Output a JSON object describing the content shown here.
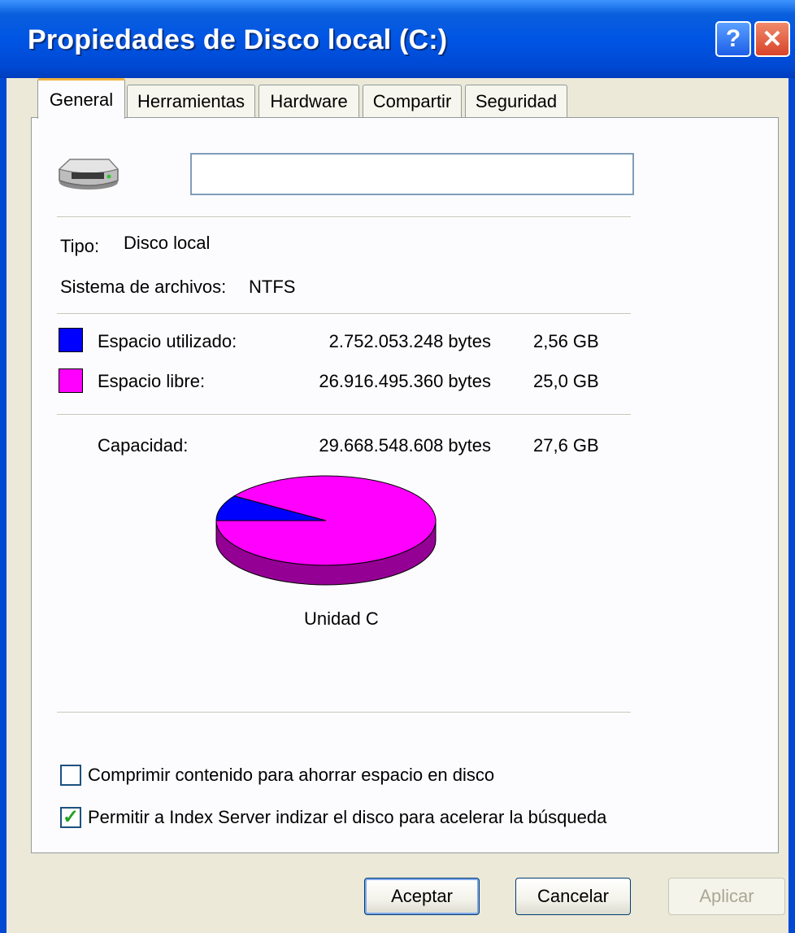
{
  "window": {
    "title": "Propiedades de Disco local (C:)",
    "help_label": "?",
    "close_label": "✕"
  },
  "tabs": [
    {
      "label": "General",
      "active": true
    },
    {
      "label": "Herramientas"
    },
    {
      "label": "Hardware"
    },
    {
      "label": "Compartir"
    },
    {
      "label": "Seguridad"
    }
  ],
  "general": {
    "drive_name_value": "",
    "type_label": "Tipo:",
    "type_value": "Disco local",
    "fs_label": "Sistema de archivos:",
    "fs_value": "NTFS",
    "used": {
      "label": "Espacio utilizado:",
      "bytes": "2.752.053.248 bytes",
      "size": "2,56 GB",
      "color": "#0000ff"
    },
    "free": {
      "label": "Espacio libre:",
      "bytes": "26.916.495.360 bytes",
      "size": "25,0 GB",
      "color": "#ff00ff"
    },
    "capacity": {
      "label": "Capacidad:",
      "bytes": "29.668.548.608 bytes",
      "size": "27,6 GB"
    },
    "drive_label": "Unidad C",
    "compress_label": "Comprimir contenido para ahorrar espacio en disco",
    "compress_checked": false,
    "index_label": "Permitir a Index Server indizar el disco para acelerar la búsqueda",
    "index_checked": true
  },
  "chart_data": {
    "type": "pie",
    "categories": [
      "Espacio utilizado",
      "Espacio libre"
    ],
    "values": [
      2752053248,
      26916495360
    ],
    "colors": [
      "#0000ff",
      "#ff00ff"
    ]
  },
  "buttons": {
    "ok": "Aceptar",
    "cancel": "Cancelar",
    "apply": "Aplicar"
  }
}
